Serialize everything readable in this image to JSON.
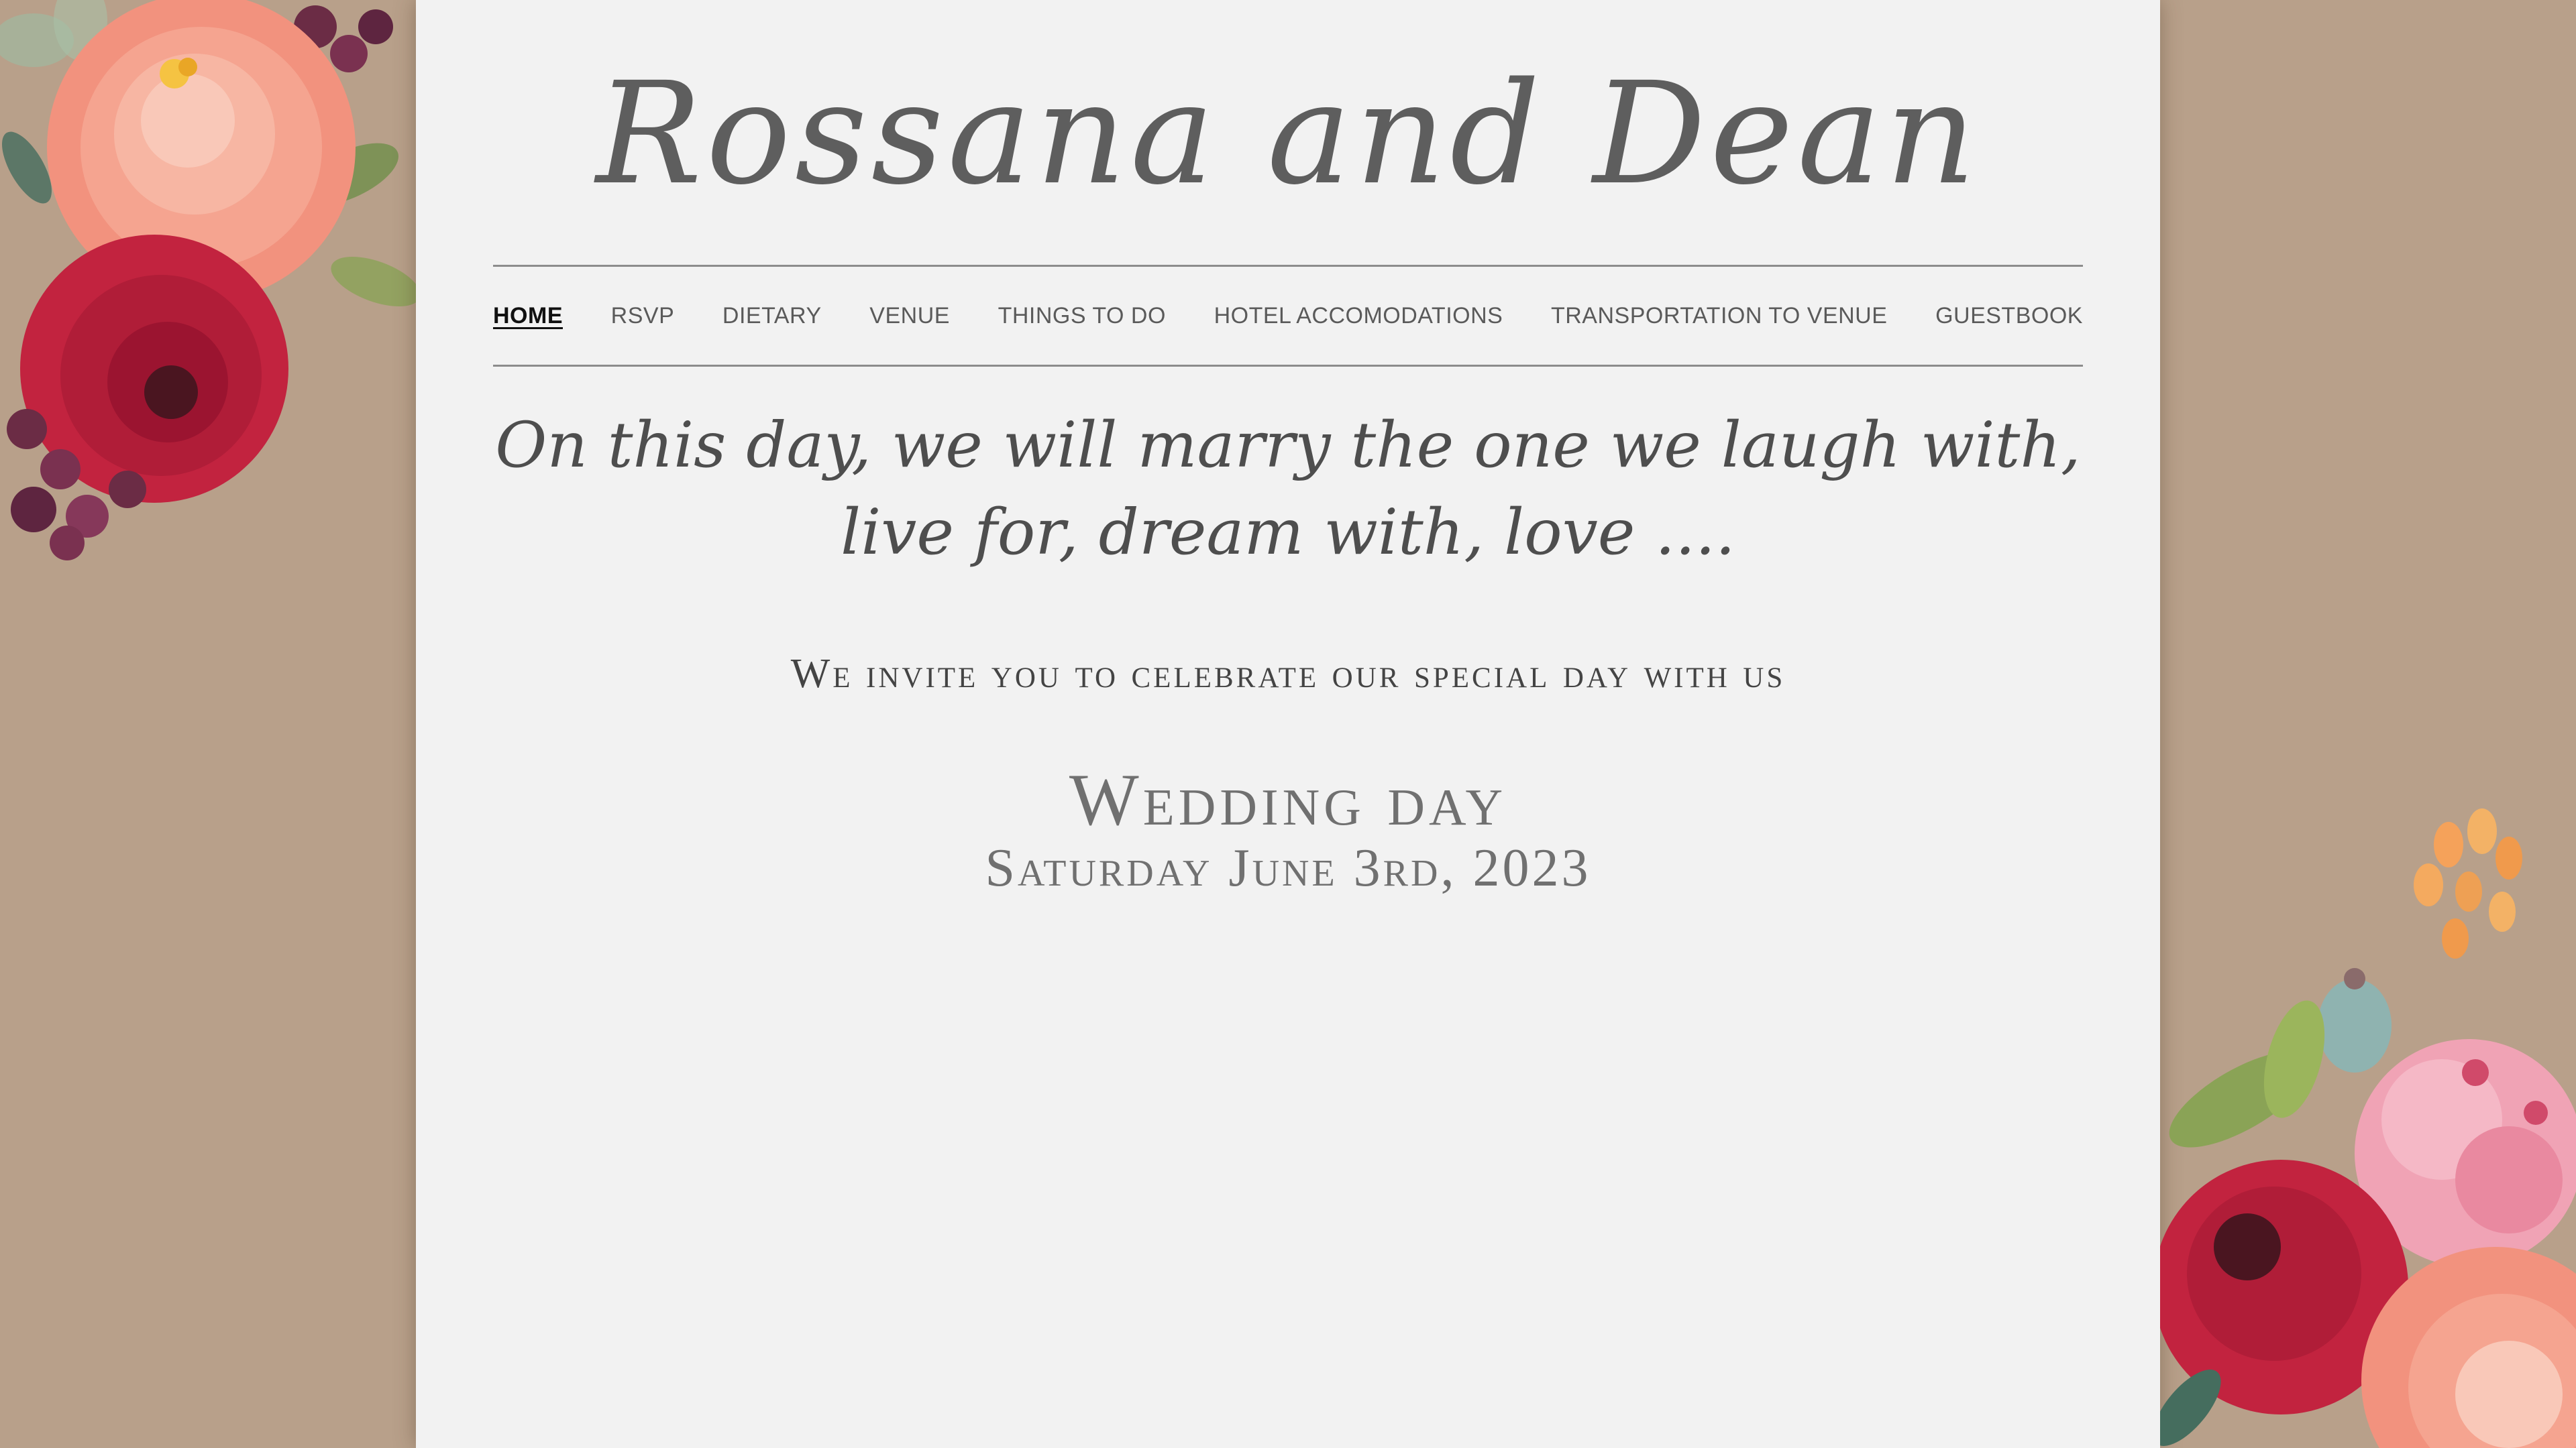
{
  "site": {
    "title": "Rossana and Dean"
  },
  "nav": {
    "items": [
      {
        "label": "HOME",
        "active": true
      },
      {
        "label": "RSVP",
        "active": false
      },
      {
        "label": "DIETARY",
        "active": false
      },
      {
        "label": "VENUE",
        "active": false
      },
      {
        "label": "THINGS TO DO",
        "active": false
      },
      {
        "label": "HOTEL ACCOMODATIONS",
        "active": false
      },
      {
        "label": "TRANSPORTATION TO VENUE",
        "active": false
      },
      {
        "label": "GUESTBOOK",
        "active": false
      }
    ]
  },
  "content": {
    "quote_line1": "On this day, we will marry the one we laugh with,",
    "quote_line2": "live for, dream with, love ....",
    "invitation": "We invite you to celebrate our special day with us",
    "wedding_label": "Wedding day",
    "wedding_date": "Saturday June 3rd, 2023"
  },
  "decor": {
    "top_left": "watercolor-flowers-icon",
    "bottom_right": "watercolor-flowers-icon"
  },
  "colors": {
    "background": "#b8a08a",
    "panel": "#f2f2f2",
    "rose_red": "#c2233f",
    "peach": "#f2927e",
    "pink": "#f0a3b5",
    "leaf_green": "#8aa356"
  }
}
